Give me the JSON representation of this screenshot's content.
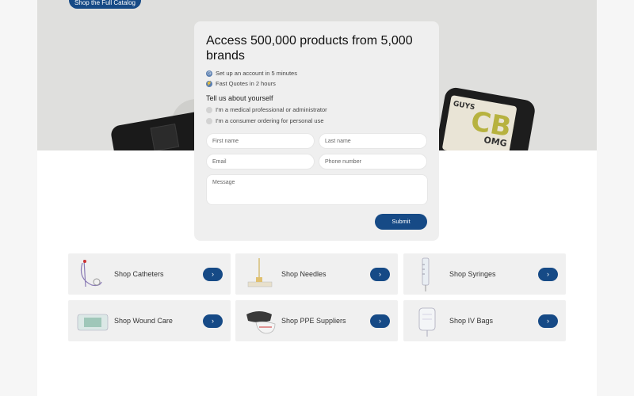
{
  "hero": {
    "catalog_button": "Shop the Full Catalog"
  },
  "form": {
    "title": "Access 500,000 products from 5,000 brands",
    "features": [
      {
        "icon": "clock-icon",
        "text": "Set up an account in 5 minutes"
      },
      {
        "icon": "lightning-icon",
        "text": "Fast Quotes in 2 hours"
      }
    ],
    "about_heading": "Tell us about yourself",
    "options": [
      "I'm a medical professional or administrator",
      "I'm a consumer ordering for personal use"
    ],
    "fields": {
      "first_name": "First name",
      "last_name": "Last name",
      "email": "Email",
      "phone": "Phone number",
      "message": "Message"
    },
    "submit": "Submit"
  },
  "categories": [
    {
      "label": "Shop Catheters",
      "icon": "catheter-icon"
    },
    {
      "label": "Shop Needles",
      "icon": "needle-icon"
    },
    {
      "label": "Shop Syringes",
      "icon": "syringe-icon"
    },
    {
      "label": "Shop Wound Care",
      "icon": "wound-care-icon"
    },
    {
      "label": "Shop PPE Suppliers",
      "icon": "ppe-icon"
    },
    {
      "label": "Shop IV Bags",
      "icon": "iv-bag-icon"
    }
  ],
  "colors": {
    "accent": "#164a86",
    "card_bg": "#efefef"
  }
}
